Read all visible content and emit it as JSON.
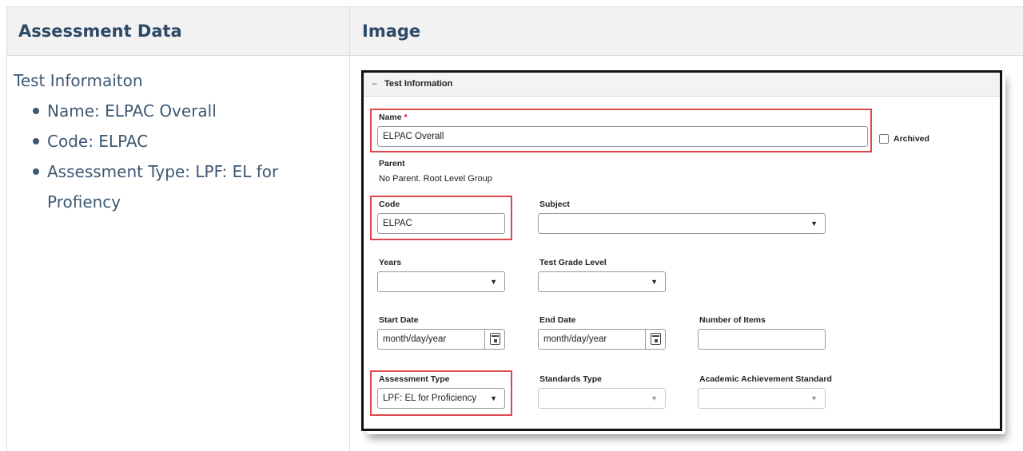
{
  "table": {
    "col1_header": "Assessment Data",
    "col2_header": "Image"
  },
  "assessment": {
    "heading": "Test Informaiton",
    "items": [
      "Name: ELPAC Overall",
      "Code: ELPAC",
      "Assessment Type: LPF: EL for Profiency"
    ]
  },
  "screenshot": {
    "section_title": "Test Information",
    "name_label": "Name",
    "required_marker": "*",
    "name_value": "ELPAC Overall",
    "archived_label": "Archived",
    "parent_label": "Parent",
    "parent_value": "No Parent. Root Level Group",
    "code_label": "Code",
    "code_value": "ELPAC",
    "subject_label": "Subject",
    "subject_value": "",
    "years_label": "Years",
    "years_value": "",
    "grade_label": "Test Grade Level",
    "grade_value": "",
    "start_label": "Start Date",
    "start_value": "month/day/year",
    "end_label": "End Date",
    "end_value": "month/day/year",
    "items_label": "Number of Items",
    "items_value": "",
    "type_label": "Assessment Type",
    "type_value": "LPF: EL for Proficiency",
    "standards_label": "Standards Type",
    "standards_value": "",
    "achievement_label": "Academic Achievement Standard",
    "achievement_value": "",
    "highlight_color": "#e0474c",
    "caret": "▼",
    "collapse_glyph": "−"
  }
}
